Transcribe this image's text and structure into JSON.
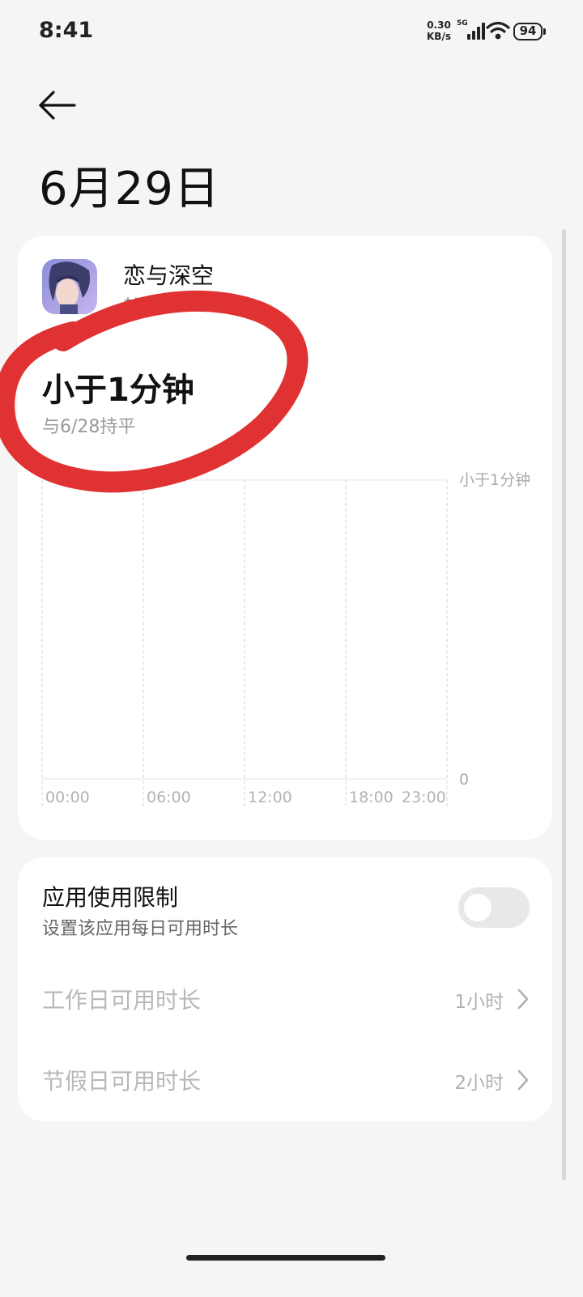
{
  "status_bar": {
    "time": "8:41",
    "net_speed_value": "0.30",
    "net_speed_unit": "KB/s",
    "network": "5G",
    "battery": "94",
    "icons": [
      "signal-icon",
      "wifi-icon",
      "battery-icon"
    ]
  },
  "header": {
    "back_icon": "arrow-left-icon",
    "date": "6月29日"
  },
  "usage_card": {
    "app_name": "恋与深空",
    "app_category": "其他",
    "usage": "小于1分钟",
    "compare": "与6/28持平"
  },
  "chart_data": {
    "type": "bar",
    "categories": [
      "00:00",
      "06:00",
      "12:00",
      "18:00",
      "23:00"
    ],
    "series": [
      {
        "values": [
          0,
          0,
          0,
          0,
          0
        ]
      }
    ],
    "y_tick_labels": [
      "小于1分钟",
      "0"
    ],
    "grid": true
  },
  "limit_card": {
    "title": "应用使用限制",
    "subtitle": "设置该应用每日可用时长",
    "toggle_on": false,
    "rows": [
      {
        "label": "工作日可用时长",
        "value": "1小时"
      },
      {
        "label": "节假日可用时长",
        "value": "2小时"
      }
    ]
  },
  "colors": {
    "background": "#f5f5f5",
    "card": "#ffffff",
    "annotation_red": "#e03232",
    "muted_text": "#b8b8b8"
  }
}
